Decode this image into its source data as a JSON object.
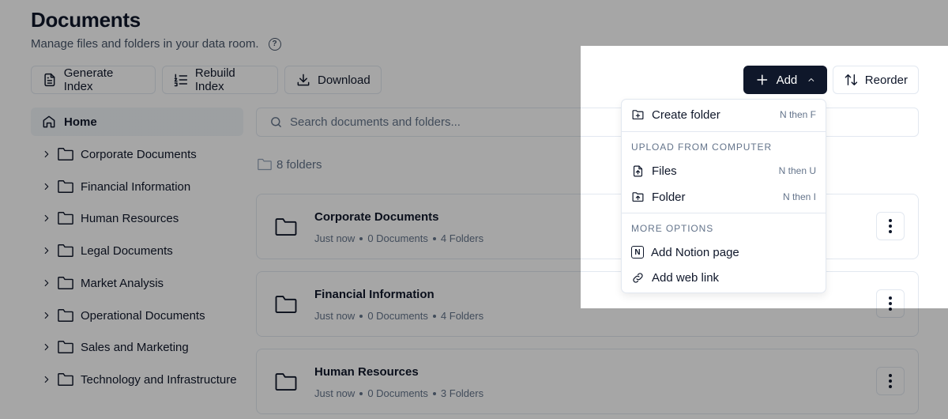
{
  "header": {
    "title": "Documents",
    "subtitle": "Manage files and folders in your data room.",
    "help_icon": "question-circle-icon"
  },
  "toolbar": {
    "generate_index": "Generate Index",
    "rebuild_index": "Rebuild Index",
    "download": "Download",
    "add": "Add",
    "reorder": "Reorder"
  },
  "sidebar": {
    "home": "Home",
    "items": [
      {
        "label": "Corporate Documents"
      },
      {
        "label": "Financial Information"
      },
      {
        "label": "Human Resources"
      },
      {
        "label": "Legal Documents"
      },
      {
        "label": "Market Analysis"
      },
      {
        "label": "Operational Documents"
      },
      {
        "label": "Sales and Marketing"
      },
      {
        "label": "Technology and Infrastructure"
      }
    ]
  },
  "search": {
    "placeholder": "Search documents and folders...",
    "value": ""
  },
  "folder_count": "8 folders",
  "folders": [
    {
      "name": "Corporate Documents",
      "updated": "Just now",
      "documents": "0 Documents",
      "folders": "4 Folders"
    },
    {
      "name": "Financial Information",
      "updated": "Just now",
      "documents": "0 Documents",
      "folders": "4 Folders"
    },
    {
      "name": "Human Resources",
      "updated": "Just now",
      "documents": "0 Documents",
      "folders": "3 Folders"
    }
  ],
  "add_menu": {
    "create_folder": {
      "label": "Create folder",
      "shortcut": "N then F"
    },
    "upload_section": "UPLOAD FROM COMPUTER",
    "files": {
      "label": "Files",
      "shortcut": "N then U"
    },
    "folder": {
      "label": "Folder",
      "shortcut": "N then I"
    },
    "more_section": "MORE OPTIONS",
    "notion": {
      "label": "Add Notion page",
      "icon_letter": "N"
    },
    "web_link": {
      "label": "Add web link"
    }
  },
  "colors": {
    "primary": "#0f172a",
    "muted": "#64748b",
    "border": "#e2e8f0",
    "sidebar_active": "#f1f5f9"
  }
}
